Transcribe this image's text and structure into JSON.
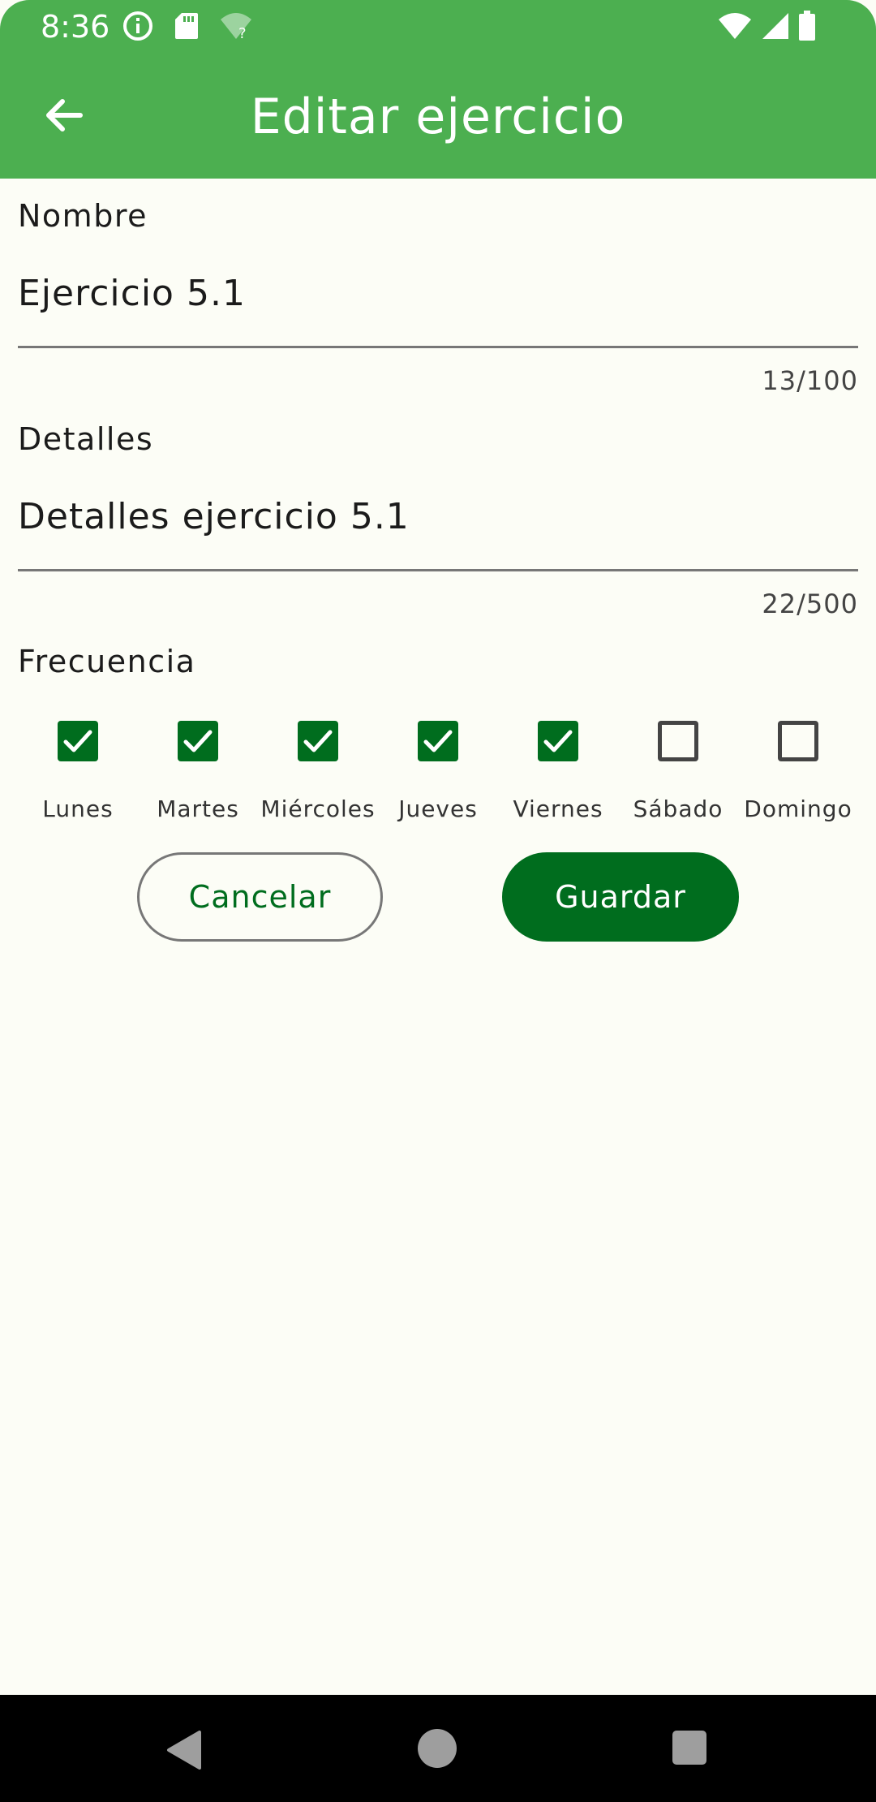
{
  "status_bar": {
    "time": "8:36",
    "left_icons": [
      "info-icon",
      "sd-card-icon",
      "wifi-unknown-icon"
    ],
    "right_icons": [
      "wifi-icon",
      "signal-icon",
      "battery-icon"
    ]
  },
  "app_bar": {
    "title": "Editar ejercicio",
    "back_icon": "arrow-back-icon"
  },
  "form": {
    "name": {
      "label": "Nombre",
      "value": "Ejercicio 5.1",
      "counter": "13/100"
    },
    "details": {
      "label": "Detalles",
      "value": "Detalles ejercicio 5.1",
      "counter": "22/500"
    },
    "frequency": {
      "label": "Frecuencia",
      "days": [
        {
          "label": "Lunes",
          "checked": true
        },
        {
          "label": "Martes",
          "checked": true
        },
        {
          "label": "Miércoles",
          "checked": true
        },
        {
          "label": "Jueves",
          "checked": true
        },
        {
          "label": "Viernes",
          "checked": true
        },
        {
          "label": "Sábado",
          "checked": false
        },
        {
          "label": "Domingo",
          "checked": false
        }
      ]
    }
  },
  "actions": {
    "cancel_label": "Cancelar",
    "save_label": "Guardar"
  },
  "colors": {
    "app_bar": "#4CAF50",
    "primary": "#006D1E",
    "background": "#FCFDF6"
  }
}
